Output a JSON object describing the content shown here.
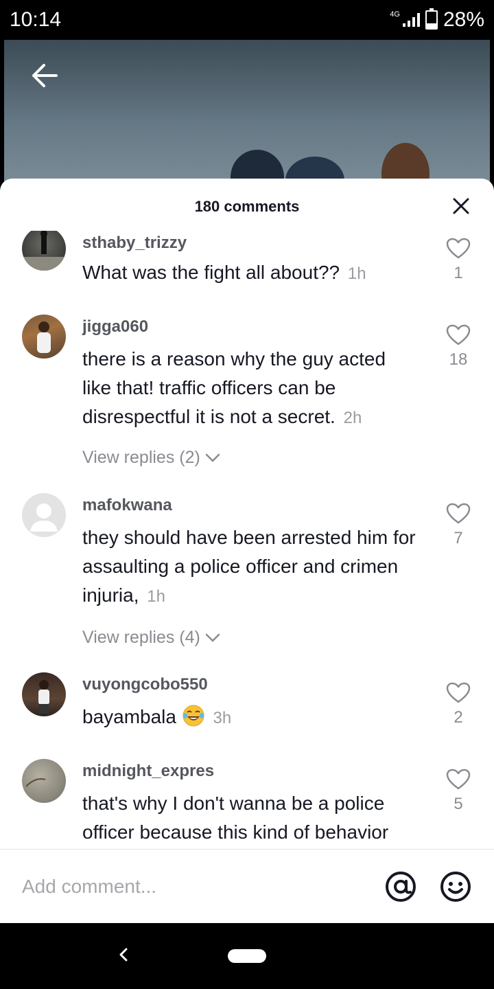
{
  "status_bar": {
    "time": "10:14",
    "network": "4G",
    "battery": "28%",
    "battery_level": 0.28
  },
  "video": {
    "back_icon": "arrow-left-icon"
  },
  "sheet": {
    "title": "180 comments",
    "close_icon": "close-icon"
  },
  "comments": [
    {
      "user": "sthaby_trizzy",
      "text": "What was the fight all about??",
      "time": "1h",
      "likes": "1"
    },
    {
      "user": "jigga060",
      "text": "there is a reason why the guy acted like that! traffic officers can be disrespectful it is not a secret.",
      "time": "2h",
      "likes": "18",
      "replies": "View replies (2)"
    },
    {
      "user": "mafokwana",
      "text": "they should have been arrested him for assaulting a police officer and crimen injuria,",
      "time": "1h",
      "likes": "7",
      "replies": "View replies (4)"
    },
    {
      "user": "vuyongcobo550",
      "text": "bayambala",
      "emoji": "laughing-tears-emoji",
      "time": "3h",
      "likes": "2"
    },
    {
      "user": "midnight_expres",
      "text": "that's why I don't wanna be a police officer because this kind of behavior",
      "time": "",
      "likes": "5"
    }
  ],
  "input": {
    "placeholder": "Add comment...",
    "mention_icon": "at-sign-icon",
    "emoji_icon": "smiley-icon"
  },
  "nav": {
    "back_icon": "nav-back-icon",
    "home_icon": "home-pill-icon"
  },
  "colors": {
    "accent_text": "#161823",
    "muted_text": "#8a8b91",
    "sheet_bg": "#ffffff"
  }
}
